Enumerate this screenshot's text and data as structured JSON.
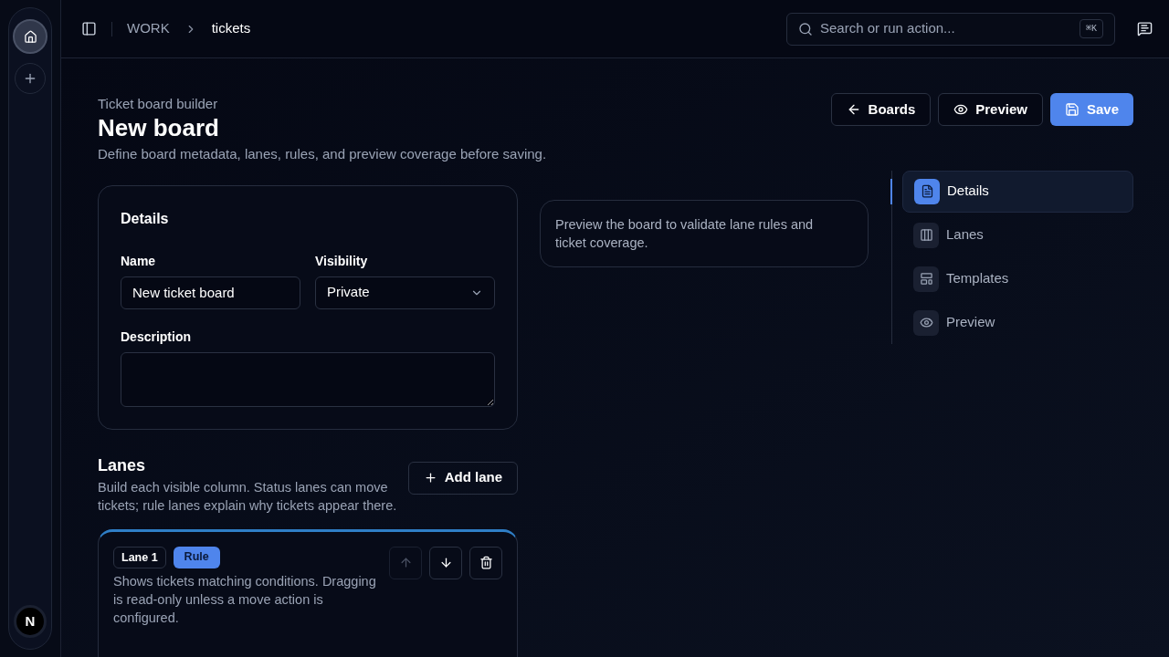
{
  "breadcrumb": [
    "WORK",
    "tickets"
  ],
  "search": {
    "placeholder": "Search or run action...",
    "shortcut": "⌘K"
  },
  "avatar": "N",
  "page": {
    "eyebrow": "Ticket board builder",
    "title": "New board",
    "subtitle": "Define board metadata, lanes, rules, and preview coverage before saving."
  },
  "actions": [
    {
      "label": "Boards",
      "kind": "back"
    },
    {
      "label": "Preview",
      "kind": "preview"
    },
    {
      "label": "Save",
      "kind": "save"
    }
  ],
  "details": {
    "title": "Details",
    "name_label": "Name",
    "name_value": "New ticket board",
    "visibility_label": "Visibility",
    "visibility_value": "Private",
    "description_label": "Description"
  },
  "lanes": {
    "title": "Lanes",
    "description": "Build each visible column. Status lanes can move tickets; rule lanes explain why tickets appear there.",
    "add_label": "Add lane",
    "items": [
      {
        "number": "Lane 1",
        "type": "Rule",
        "description": "Shows tickets matching conditions. Dragging is read-only unless a move action is configured.",
        "up_disabled": true,
        "down_disabled": false
      }
    ]
  },
  "preview_note": "Preview the board to validate lane rules and ticket coverage.",
  "sections": [
    {
      "label": "Details",
      "kind": "details",
      "selected": true
    },
    {
      "label": "Lanes",
      "kind": "lanes",
      "selected": false
    },
    {
      "label": "Templates",
      "kind": "templates",
      "selected": false
    },
    {
      "label": "Preview",
      "kind": "preview",
      "selected": false
    }
  ]
}
